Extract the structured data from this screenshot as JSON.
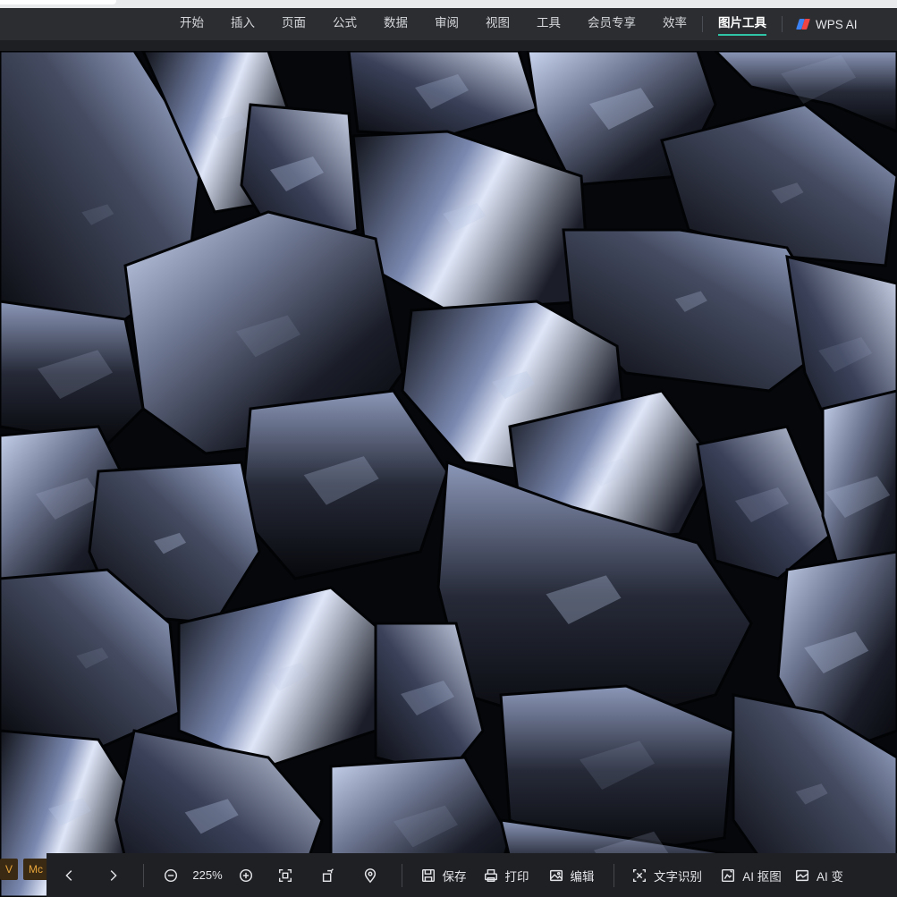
{
  "ribbon": {
    "tabs": [
      {
        "label": "开始"
      },
      {
        "label": "插入"
      },
      {
        "label": "页面"
      },
      {
        "label": "公式"
      },
      {
        "label": "数据"
      },
      {
        "label": "审阅"
      },
      {
        "label": "视图"
      },
      {
        "label": "工具"
      },
      {
        "label": "会员专享"
      },
      {
        "label": "效率"
      }
    ],
    "active_tab": "图片工具",
    "wps_ai": "WPS AI"
  },
  "left_chips": [
    "V",
    "Mc"
  ],
  "toolbar": {
    "zoom": "225%",
    "save": "保存",
    "print": "打印",
    "edit": "编辑",
    "ocr": "文字识别",
    "ai_cutout": "AI 抠图",
    "ai_transform": "AI 变"
  },
  "colors": {
    "ribbon_bg": "#2b2d31",
    "toolbar_bg": "#1f2024",
    "accent": "#2ec4a5"
  },
  "photo": {
    "subject": "pile of shiny dark silicon metal chunks",
    "highlight_color": "#b9c7e6"
  }
}
